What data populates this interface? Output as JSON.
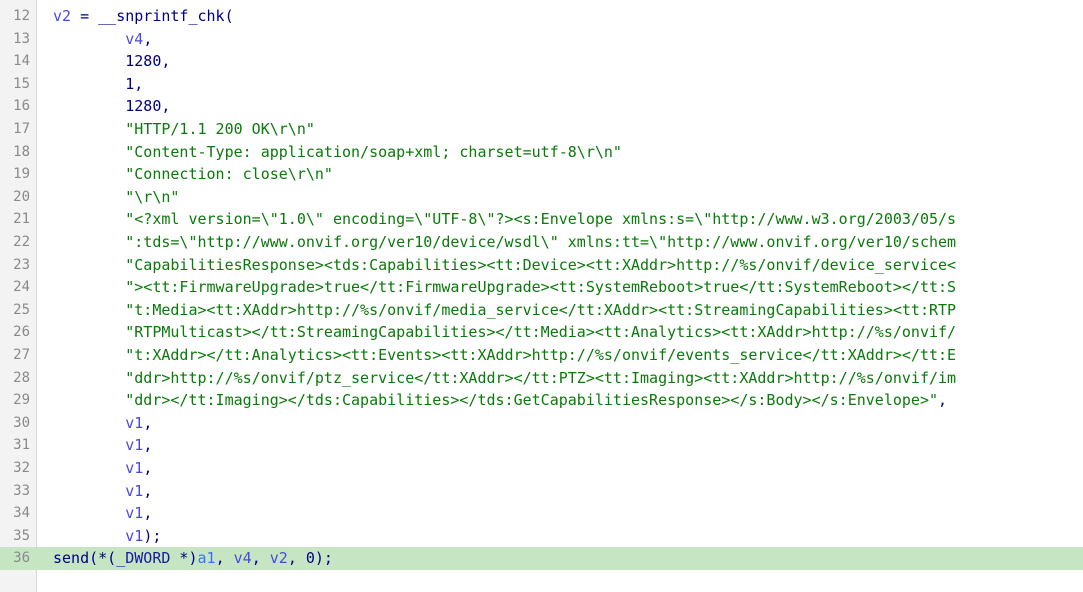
{
  "lines": [
    {
      "n": "12",
      "indent": "",
      "segs": [
        {
          "c": "var",
          "t": "v2"
        },
        {
          "c": "kw",
          "t": " = __snprintf_chk("
        }
      ]
    },
    {
      "n": "13",
      "indent": "        ",
      "segs": [
        {
          "c": "var",
          "t": "v4"
        },
        {
          "c": "kw",
          "t": ","
        }
      ]
    },
    {
      "n": "14",
      "indent": "        ",
      "segs": [
        {
          "c": "num",
          "t": "1280"
        },
        {
          "c": "kw",
          "t": ","
        }
      ]
    },
    {
      "n": "15",
      "indent": "        ",
      "segs": [
        {
          "c": "num",
          "t": "1"
        },
        {
          "c": "kw",
          "t": ","
        }
      ]
    },
    {
      "n": "16",
      "indent": "        ",
      "segs": [
        {
          "c": "num",
          "t": "1280"
        },
        {
          "c": "kw",
          "t": ","
        }
      ]
    },
    {
      "n": "17",
      "indent": "        ",
      "segs": [
        {
          "c": "str",
          "t": "\"HTTP/1.1 200 OK\\r\\n\""
        }
      ]
    },
    {
      "n": "18",
      "indent": "        ",
      "segs": [
        {
          "c": "str",
          "t": "\"Content-Type: application/soap+xml; charset=utf-8\\r\\n\""
        }
      ]
    },
    {
      "n": "19",
      "indent": "        ",
      "segs": [
        {
          "c": "str",
          "t": "\"Connection: close\\r\\n\""
        }
      ]
    },
    {
      "n": "20",
      "indent": "        ",
      "segs": [
        {
          "c": "str",
          "t": "\"\\r\\n\""
        }
      ]
    },
    {
      "n": "21",
      "indent": "        ",
      "segs": [
        {
          "c": "str",
          "t": "\"<?xml version=\\\"1.0\\\" encoding=\\\"UTF-8\\\"?><s:Envelope xmlns:s=\\\"http://www.w3.org/2003/05/s"
        }
      ]
    },
    {
      "n": "22",
      "indent": "        ",
      "segs": [
        {
          "c": "str",
          "t": "\":tds=\\\"http://www.onvif.org/ver10/device/wsdl\\\" xmlns:tt=\\\"http://www.onvif.org/ver10/schem"
        }
      ]
    },
    {
      "n": "23",
      "indent": "        ",
      "segs": [
        {
          "c": "str",
          "t": "\"CapabilitiesResponse><tds:Capabilities><tt:Device><tt:XAddr>http://%s/onvif/device_service<"
        }
      ]
    },
    {
      "n": "24",
      "indent": "        ",
      "segs": [
        {
          "c": "str",
          "t": "\"><tt:FirmwareUpgrade>true</tt:FirmwareUpgrade><tt:SystemReboot>true</tt:SystemReboot></tt:S"
        }
      ]
    },
    {
      "n": "25",
      "indent": "        ",
      "segs": [
        {
          "c": "str",
          "t": "\"t:Media><tt:XAddr>http://%s/onvif/media_service</tt:XAddr><tt:StreamingCapabilities><tt:RTP"
        }
      ]
    },
    {
      "n": "26",
      "indent": "        ",
      "segs": [
        {
          "c": "str",
          "t": "\"RTPMulticast></tt:StreamingCapabilities></tt:Media><tt:Analytics><tt:XAddr>http://%s/onvif/"
        }
      ]
    },
    {
      "n": "27",
      "indent": "        ",
      "segs": [
        {
          "c": "str",
          "t": "\"t:XAddr></tt:Analytics><tt:Events><tt:XAddr>http://%s/onvif/events_service</tt:XAddr></tt:E"
        }
      ]
    },
    {
      "n": "28",
      "indent": "        ",
      "segs": [
        {
          "c": "str",
          "t": "\"ddr>http://%s/onvif/ptz_service</tt:XAddr></tt:PTZ><tt:Imaging><tt:XAddr>http://%s/onvif/im"
        }
      ]
    },
    {
      "n": "29",
      "indent": "        ",
      "segs": [
        {
          "c": "str",
          "t": "\"ddr></tt:Imaging></tds:Capabilities></tds:GetCapabilitiesResponse></s:Body></s:Envelope>\""
        },
        {
          "c": "kw",
          "t": ","
        }
      ]
    },
    {
      "n": "30",
      "indent": "        ",
      "segs": [
        {
          "c": "var",
          "t": "v1"
        },
        {
          "c": "kw",
          "t": ","
        }
      ]
    },
    {
      "n": "31",
      "indent": "        ",
      "segs": [
        {
          "c": "var",
          "t": "v1"
        },
        {
          "c": "kw",
          "t": ","
        }
      ]
    },
    {
      "n": "32",
      "indent": "        ",
      "segs": [
        {
          "c": "var",
          "t": "v1"
        },
        {
          "c": "kw",
          "t": ","
        }
      ]
    },
    {
      "n": "33",
      "indent": "        ",
      "segs": [
        {
          "c": "var",
          "t": "v1"
        },
        {
          "c": "kw",
          "t": ","
        }
      ]
    },
    {
      "n": "34",
      "indent": "        ",
      "segs": [
        {
          "c": "var",
          "t": "v1"
        },
        {
          "c": "kw",
          "t": ","
        }
      ]
    },
    {
      "n": "35",
      "indent": "        ",
      "segs": [
        {
          "c": "var",
          "t": "v1"
        },
        {
          "c": "kw",
          "t": ");"
        }
      ]
    },
    {
      "n": "36",
      "indent": "",
      "highlight": true,
      "segs": [
        {
          "c": "fn",
          "t": "send(*("
        },
        {
          "c": "dw",
          "t": "_DWORD"
        },
        {
          "c": "kw",
          "t": " *)"
        },
        {
          "c": "param",
          "t": "a1"
        },
        {
          "c": "kw",
          "t": ", "
        },
        {
          "c": "var",
          "t": "v4"
        },
        {
          "c": "kw",
          "t": ", "
        },
        {
          "c": "var",
          "t": "v2"
        },
        {
          "c": "kw",
          "t": ", "
        },
        {
          "c": "num",
          "t": "0"
        },
        {
          "c": "kw",
          "t": ");"
        }
      ]
    }
  ],
  "colors": {
    "background": "#ffffff",
    "gutter": "#f3f3f3",
    "line_number": "#8a8a8a",
    "current_line_highlight": "#c5e5c3",
    "string": "#0a7a0a",
    "variable": "#4a4ad8",
    "keyword": "#000080"
  }
}
